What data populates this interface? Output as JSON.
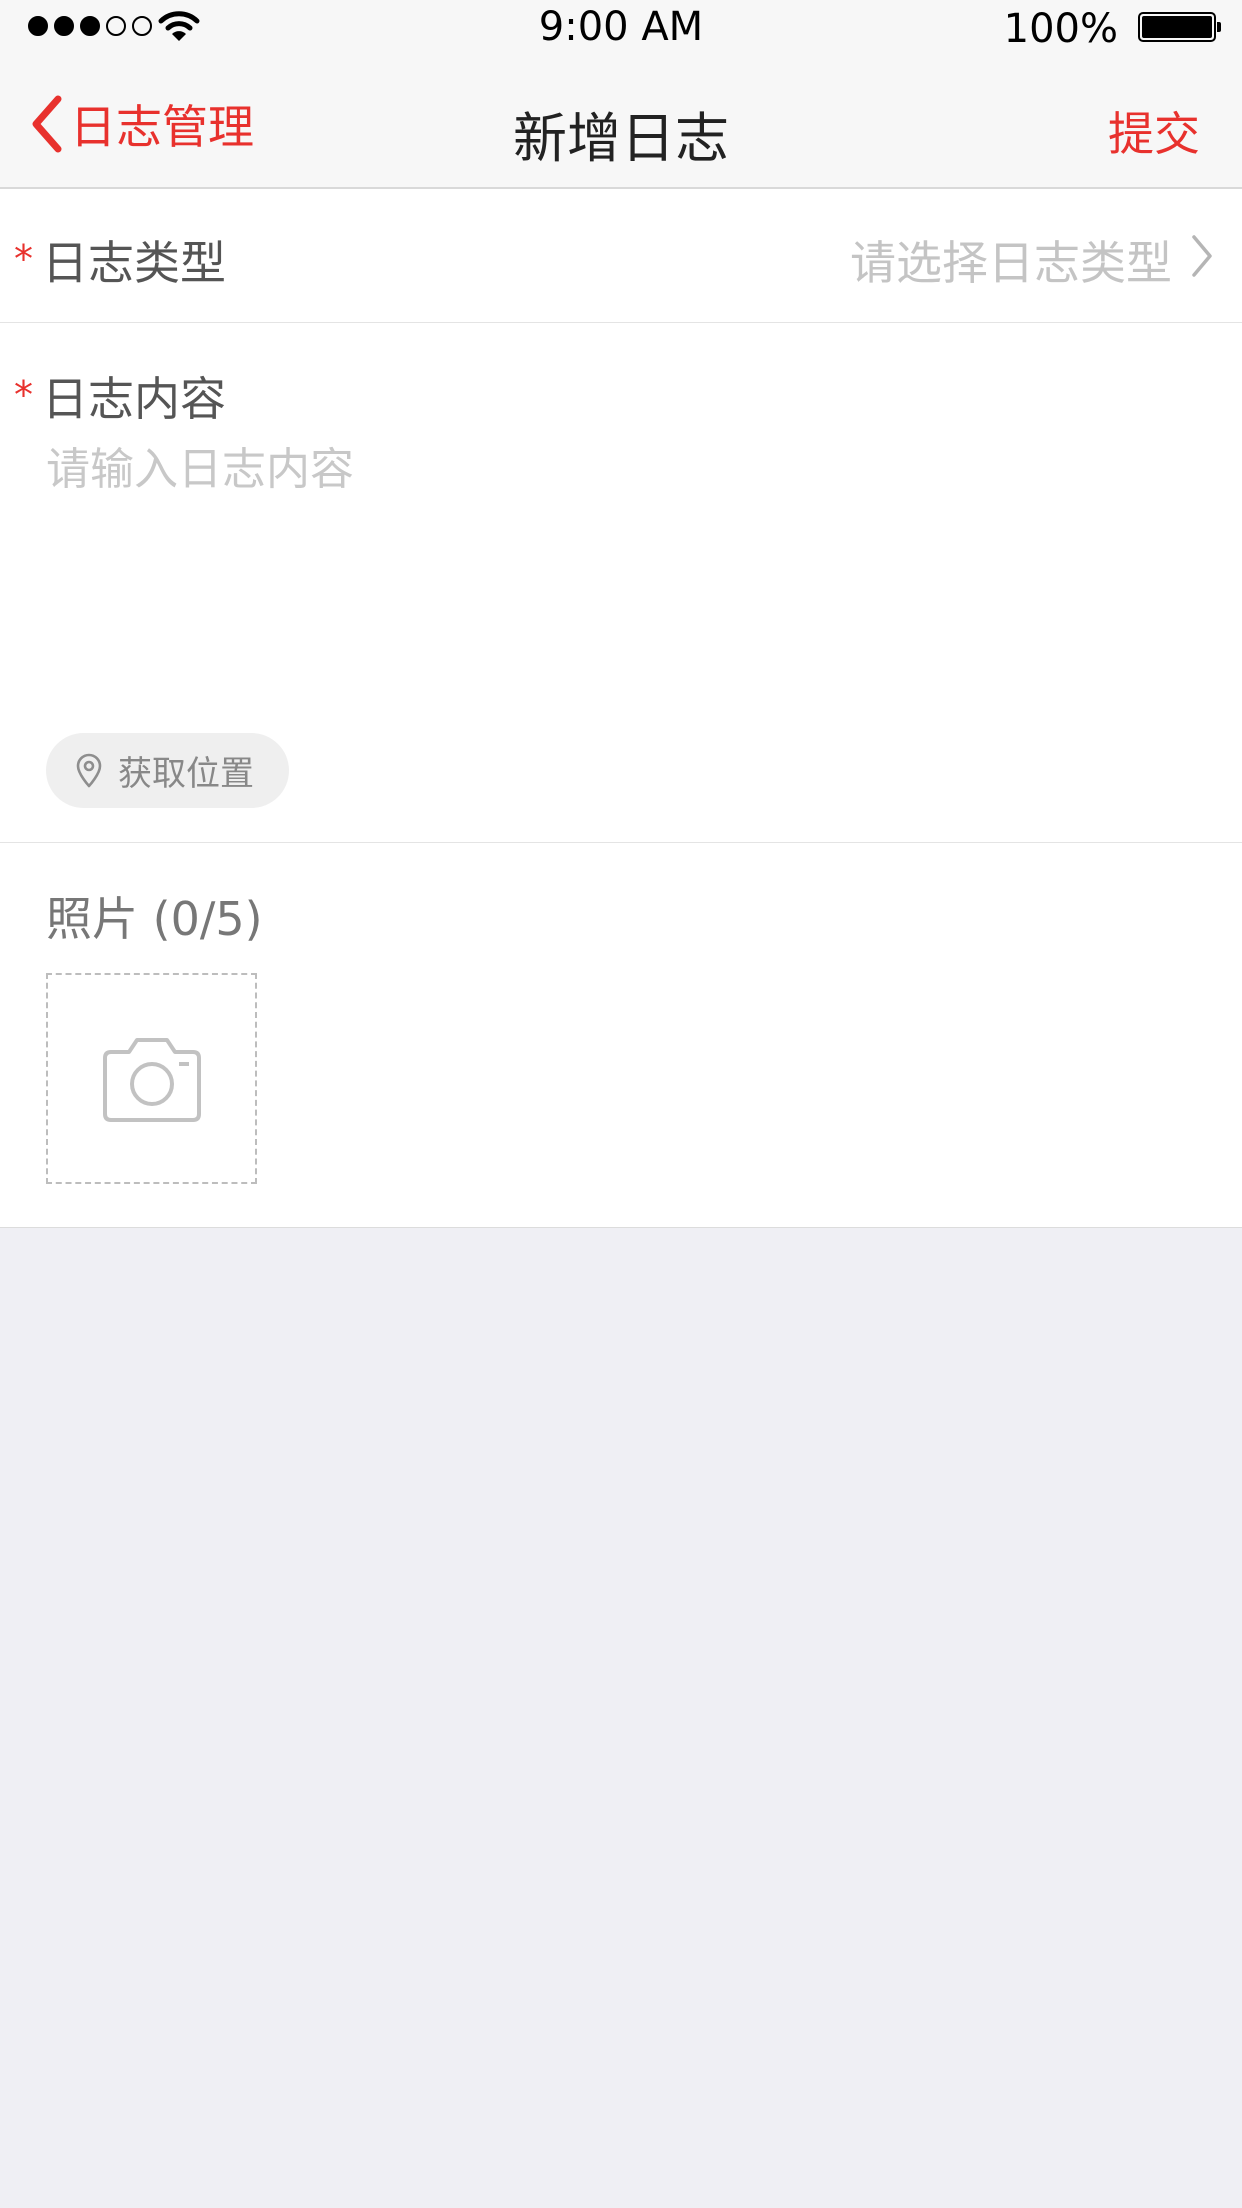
{
  "status_bar": {
    "time": "9:00 AM",
    "battery_text": "100%",
    "signal_bars_filled": 3,
    "signal_bars_total": 5,
    "icons": [
      "signal-icon",
      "wifi-icon",
      "battery-icon"
    ]
  },
  "nav": {
    "back_label": "日志管理",
    "title": "新增日志",
    "submit_label": "提交"
  },
  "form": {
    "type": {
      "required_mark": "*",
      "label": "日志类型",
      "placeholder": "请选择日志类型"
    },
    "content": {
      "required_mark": "*",
      "label": "日志内容",
      "placeholder": "请输入日志内容",
      "value": ""
    },
    "location": {
      "label": "获取位置"
    },
    "photos": {
      "title": "照片 (0/5)"
    }
  },
  "colors": {
    "accent": "#e8312d",
    "background": "#efeff4",
    "bar_background": "#f7f7f7",
    "placeholder": "#c4c4c4"
  }
}
